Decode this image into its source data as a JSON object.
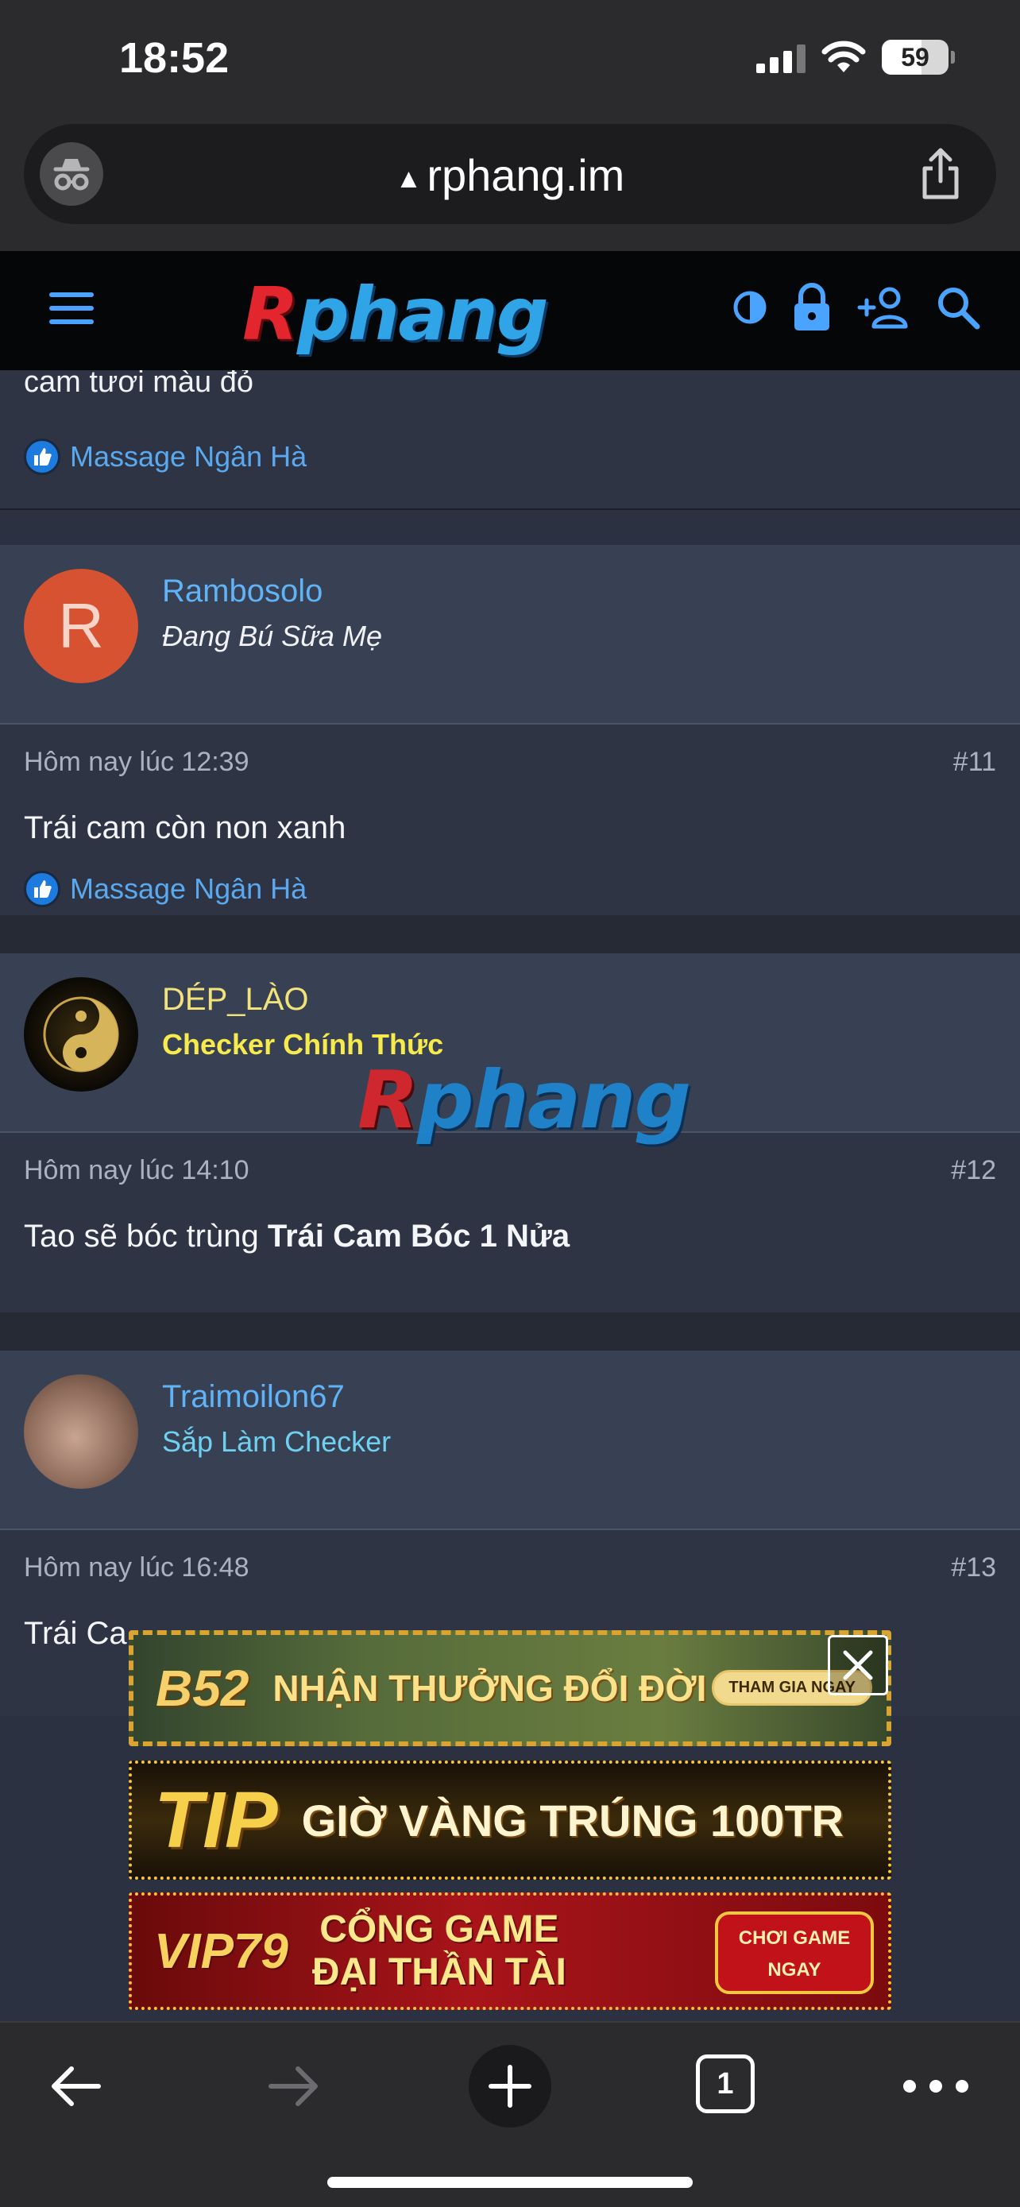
{
  "status_bar": {
    "time": "18:52",
    "battery": "59",
    "battery_level": 0.59
  },
  "browser": {
    "url": "rphang.im",
    "warning_glyph": "▲"
  },
  "site": {
    "logo_first": "R",
    "logo_rest": "phang",
    "accent": "#2fa4e7"
  },
  "previous_post": {
    "message": "cam tươi màu đỏ",
    "reaction": "Massage Ngân Hà"
  },
  "posts": [
    {
      "username": "Rambosolo",
      "avatar_letter": "R",
      "user_title": "Đang Bú Sữa Mẹ",
      "timestamp": "Hôm nay lúc 12:39",
      "post_number": "#11",
      "body": "Trái cam còn non xanh",
      "reaction": "Massage Ngân Hà"
    },
    {
      "username": "DÉP_LÀO",
      "user_title": "Checker Chính Thức",
      "timestamp": "Hôm nay lúc 14:10",
      "post_number": "#12",
      "body_prefix": "Tao sẽ bóc trùng ",
      "body_bold": "Trái Cam Bóc 1 Nửa"
    },
    {
      "username": "Traimoilon67",
      "user_title": "Sắp Làm Checker",
      "timestamp": "Hôm nay lúc 16:48",
      "post_number": "#13",
      "body": "Trái Ca"
    }
  ],
  "watermark": {
    "first": "R",
    "rest": "phang"
  },
  "ads": [
    {
      "brand": "B52",
      "headline": "NHẬN THƯỞNG ĐỔI ĐỜI",
      "cta": "THAM GIA NGAY"
    },
    {
      "brand": "TIP",
      "headline": "GIỜ VÀNG TRÚNG 100TR"
    },
    {
      "brand": "VIP79",
      "headline_line1": "CỔNG GAME",
      "headline_line2": "ĐẠI THẦN TÀI",
      "cta_line1": "CHƠI GAME",
      "cta_line2": "NGAY"
    }
  ],
  "toolbar": {
    "tab_count": "1"
  },
  "icons": {
    "incognito": "incognito-icon",
    "share": "share-icon",
    "menu": "menu-icon",
    "theme": "theme-toggle-icon",
    "login": "lock-icon",
    "register": "add-user-icon",
    "search": "search-icon",
    "like": "like-icon",
    "close": "close-icon",
    "back": "back-arrow-icon",
    "forward": "forward-arrow-icon",
    "new_tab": "plus-icon",
    "tabs": "tabs-icon",
    "more": "more-icon"
  }
}
